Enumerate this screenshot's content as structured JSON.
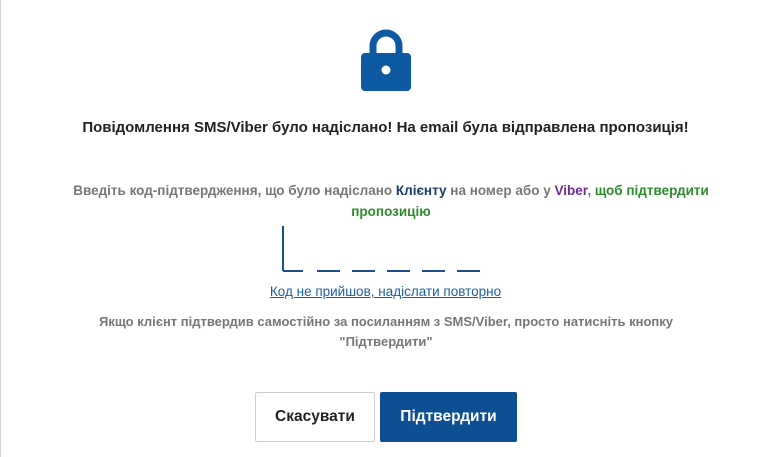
{
  "icon": {
    "name": "lock-icon",
    "color": "#0d5aa3"
  },
  "title": "Повідомлення SMS/Viber було надіслано! На email була відправлена пропозиція!",
  "instruction": {
    "part1": "Введіть код-підтвердження, що було надіслано ",
    "client": "Клієнту",
    "part2": " на номер або у ",
    "viber": "Viber",
    "comma": ",",
    "part3": " щоб підтвердити пропозицію"
  },
  "code_input": {
    "digits": 6,
    "value": ""
  },
  "resend_link": "Код не прийшов, надіслати повторно",
  "note": "Якщо клієнт підтвердив самостійно за посиланням з SMS/Viber, просто натисніть кнопку \"Підтвердити\"",
  "buttons": {
    "cancel": "Скасувати",
    "confirm": "Підтвердити"
  },
  "colors": {
    "primary": "#0d4f93",
    "link": "#1a5fa6",
    "green": "#2e8b2e",
    "viber": "#6b2d8f"
  }
}
